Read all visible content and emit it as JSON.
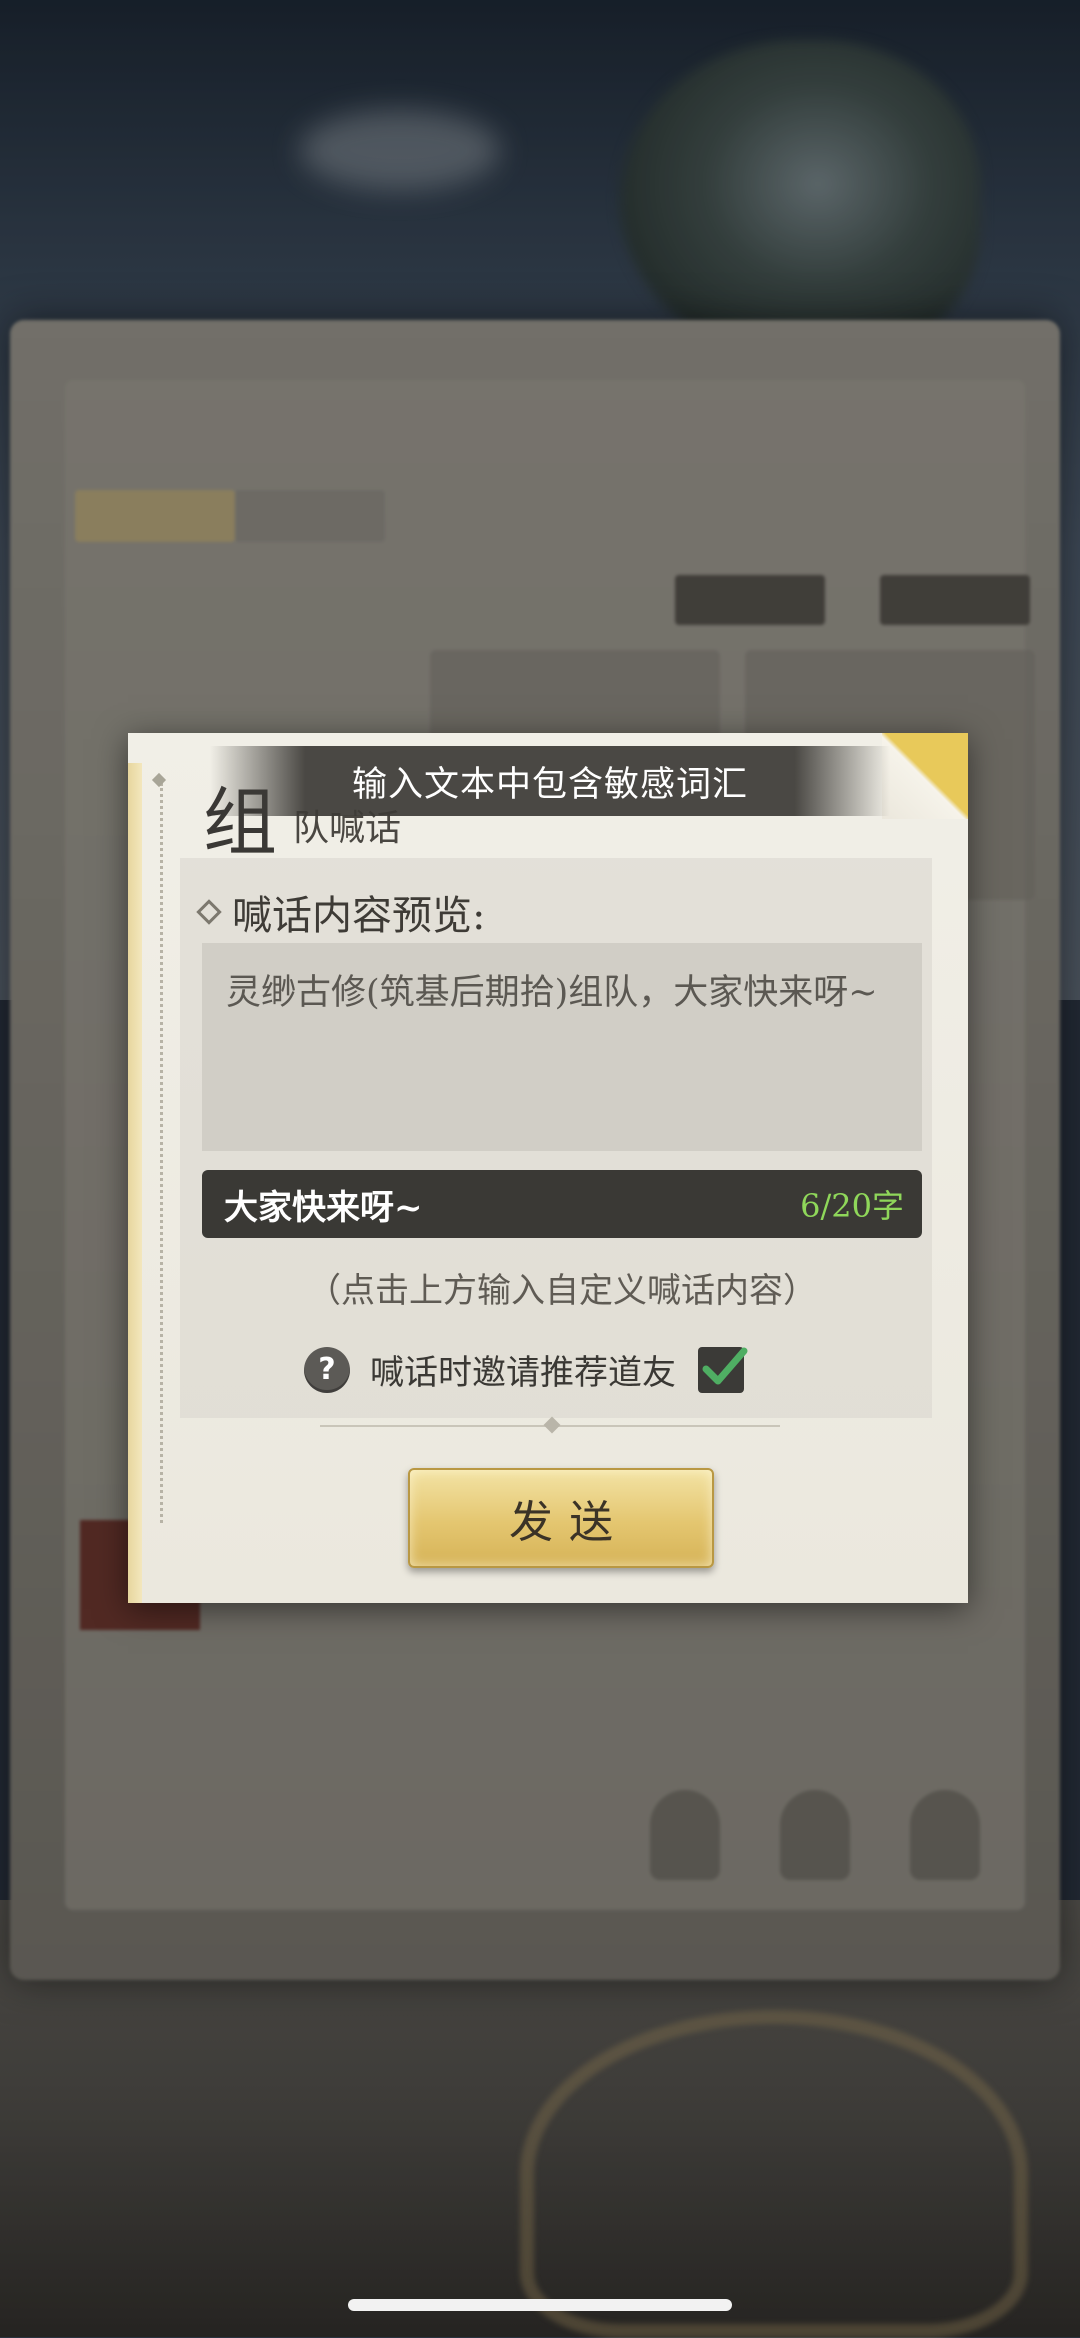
{
  "toast": {
    "message": "输入文本中包含敏感词汇"
  },
  "dialog": {
    "title_big": "组",
    "title_small": "队喊话",
    "preview_label": "喊话内容预览:",
    "preview_text": "灵缈古修(筑基后期拾)组队，大家快来呀~",
    "input": {
      "value": "大家快来呀~",
      "count": "6/20字"
    },
    "hint": "（点击上方输入自定义喊话内容）",
    "invite_label": "喊话时邀请推荐道友",
    "invite_checked": true,
    "help_icon": "?",
    "send_label": "发送"
  },
  "colors": {
    "count_green": "#8fd75a",
    "button_gold": "#e4c670",
    "check_green": "#4fae63"
  },
  "icons": [
    "help-icon",
    "checkbox-check-icon",
    "corner-fold-icon"
  ]
}
